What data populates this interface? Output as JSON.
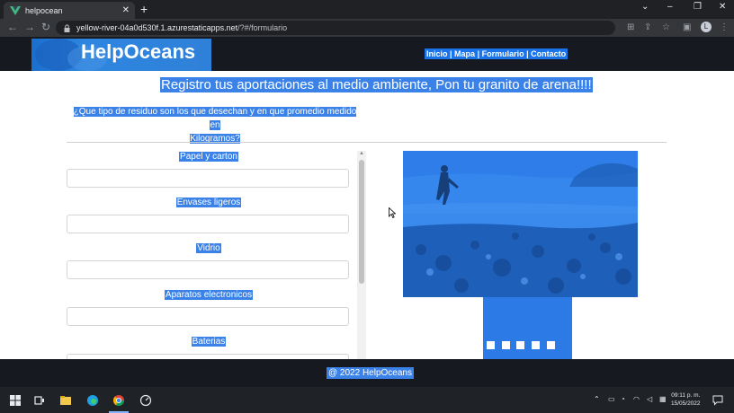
{
  "browser": {
    "tab_title": "helpocean",
    "tab_close": "✕",
    "new_tab": "+",
    "url_domain": "yellow-river-04a0d530f.1.azurestaticapps.net",
    "url_path": "/?#/formulario",
    "window_controls": [
      "⌄",
      "–",
      "❐",
      "✕"
    ],
    "profile_initial": "L"
  },
  "site": {
    "logo": "HelpOceans",
    "nav": [
      "Inicio",
      "Mapa",
      "Formulario",
      "Contacto"
    ],
    "nav_separator": " | "
  },
  "page": {
    "title": "Registro tus aportaciones al medio ambiente, Pon tu granito de arena!!!!",
    "question_line1": "¿Que tipo de residuo son los que desechan y en que promedio medido en",
    "question_line2": "Kilogramos?"
  },
  "form": {
    "fields": [
      {
        "label": "Papel y carton",
        "value": ""
      },
      {
        "label": "Envases ligeros",
        "value": ""
      },
      {
        "label": "Vidrio",
        "value": ""
      },
      {
        "label": "Aparatos electronicos",
        "value": ""
      },
      {
        "label": "Baterias",
        "value": ""
      }
    ]
  },
  "carousel": {
    "slides": 5
  },
  "footer": {
    "text": "@ 2022 HelpOceans"
  },
  "taskbar": {
    "time": "09:11 p. m.",
    "date": "15/05/2022"
  },
  "colors": {
    "accent": "#3b82e8",
    "header_bg": "#16191f",
    "photo_tint": "#2b7ae6"
  }
}
